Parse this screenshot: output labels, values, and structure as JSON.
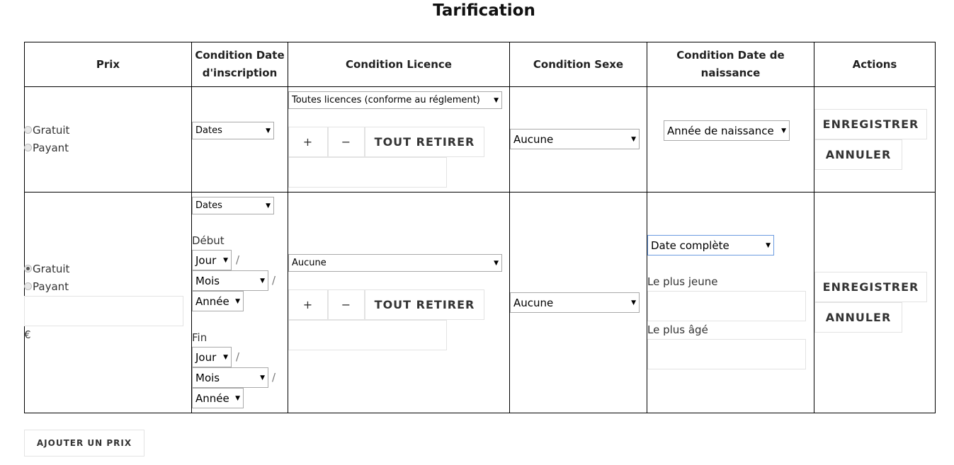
{
  "title": "Tarification",
  "headers": [
    "Prix",
    "Condition Date d'inscription",
    "Condition Licence",
    "Condition Sexe",
    "Condition Date de naissance",
    "Actions"
  ],
  "row1": {
    "price_options": [
      {
        "label": "Gratuit",
        "checked": false
      },
      {
        "label": "Payant",
        "checked": false
      }
    ],
    "date_inscription_select": "Dates",
    "licence_select": "Toutes licences (conforme au réglement)",
    "plus": "+",
    "minus": "−",
    "remove_all": "TOUT RETIRER",
    "sexe_select": "Aucune",
    "naissance_select": "Année de naissance",
    "save": "ENREGISTRER",
    "cancel": "ANNULER"
  },
  "row2": {
    "price_options": [
      {
        "label": "Gratuit",
        "checked": true
      },
      {
        "label": "Payant",
        "checked": false
      }
    ],
    "price_value": "",
    "currency": "€",
    "date_inscription_select": "Dates",
    "debut_label": "Début",
    "fin_label": "Fin",
    "day": "Jour",
    "month": "Mois",
    "year": "Année",
    "sep": "/",
    "licence_select": "Aucune",
    "plus": "+",
    "minus": "−",
    "remove_all": "TOUT RETIRER",
    "sexe_select": "Aucune",
    "naissance_select": "Date complète",
    "youngest_label": "Le plus jeune",
    "oldest_label": "Le plus âgé",
    "youngest_value": "",
    "oldest_value": "",
    "save": "ENREGISTRER",
    "cancel": "ANNULER"
  },
  "add_price": "AJOUTER UN PRIX"
}
